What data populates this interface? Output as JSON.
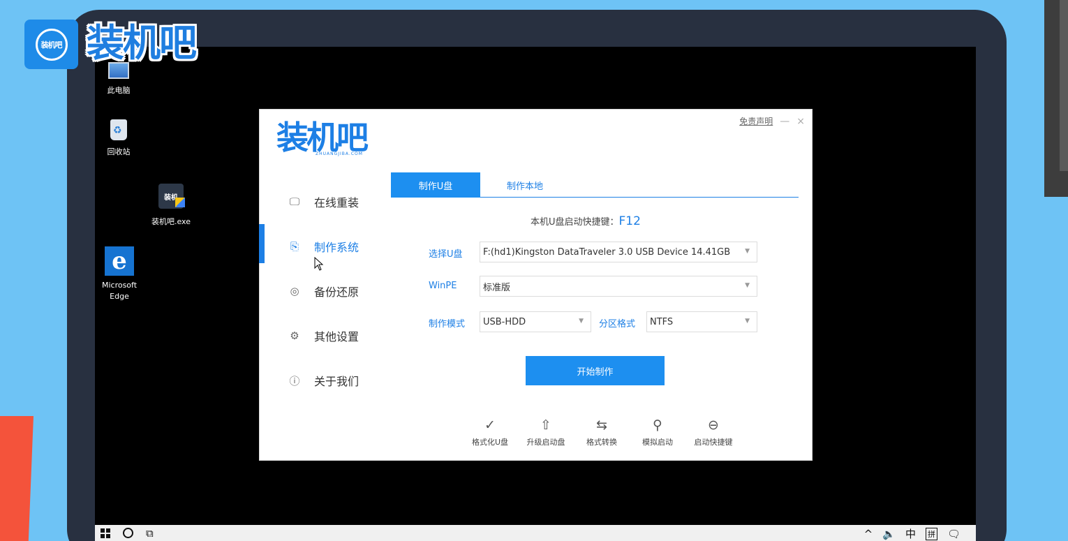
{
  "brand": {
    "badge_text": "装机吧",
    "logo_text": "装机吧"
  },
  "desktop": {
    "icons": [
      {
        "label": "此电脑"
      },
      {
        "label": "回收站"
      },
      {
        "label": "装机吧.exe",
        "icon_text": "装机"
      },
      {
        "label": "Microsoft Edge",
        "icon_text": "e"
      }
    ]
  },
  "app": {
    "logo": {
      "main": "装机吧",
      "sub": "ZHUANGJIBA.COM"
    },
    "window_controls": {
      "disclaimer": "免责声明",
      "minimize": "—",
      "close": "×"
    },
    "sidebar": [
      {
        "label": "在线重装",
        "icon": "monitor-icon",
        "glyph": "🖵"
      },
      {
        "label": "制作系统",
        "icon": "usb-icon",
        "glyph": "⎘"
      },
      {
        "label": "备份还原",
        "icon": "backup-icon",
        "glyph": "◎"
      },
      {
        "label": "其他设置",
        "icon": "settings-icon",
        "glyph": "⚙"
      },
      {
        "label": "关于我们",
        "icon": "info-icon",
        "glyph": "ⓘ"
      }
    ],
    "active_sidebar_index": 1,
    "tabs": [
      {
        "label": "制作U盘"
      },
      {
        "label": "制作本地"
      }
    ],
    "active_tab_index": 0,
    "hotkey": {
      "prefix": "本机U盘启动快捷键：",
      "key": "F12"
    },
    "form": {
      "usb_label": "选择U盘",
      "usb_value": "F:(hd1)Kingston DataTraveler 3.0 USB Device 14.41GB",
      "winpe_label": "WinPE",
      "winpe_value": "标准版",
      "mode_label": "制作模式",
      "mode_value": "USB-HDD",
      "partition_label": "分区格式",
      "partition_value": "NTFS"
    },
    "start_button": "开始制作",
    "tools": [
      {
        "label": "格式化U盘",
        "icon": "check-circle-icon",
        "glyph": "✓"
      },
      {
        "label": "升级启动盘",
        "icon": "upload-circle-icon",
        "glyph": "⇧"
      },
      {
        "label": "格式转换",
        "icon": "convert-icon",
        "glyph": "⇆"
      },
      {
        "label": "模拟启动",
        "icon": "simulate-icon",
        "glyph": "⚲"
      },
      {
        "label": "启动快捷键",
        "icon": "mouse-icon",
        "glyph": "⊖"
      }
    ]
  },
  "taskbar": {
    "ime_lang": "中",
    "ime_mode": "拼"
  },
  "colors": {
    "accent": "#1d7fe5",
    "button": "#1d8ff0",
    "background": "#6ec3f5",
    "frame": "#283040"
  }
}
